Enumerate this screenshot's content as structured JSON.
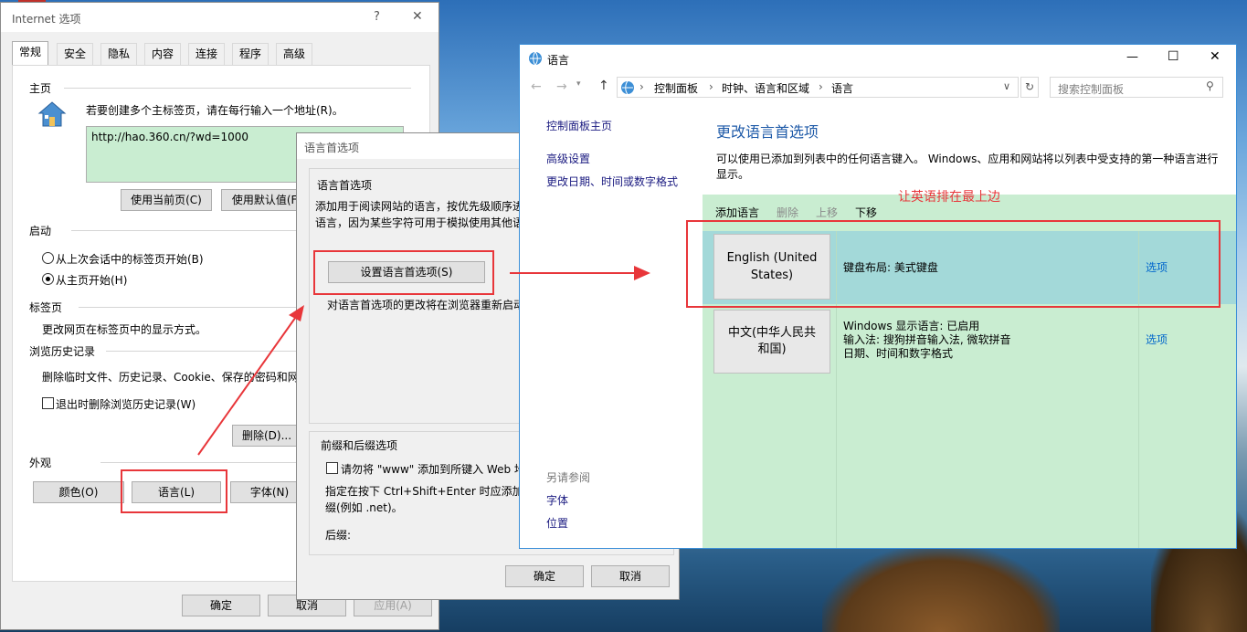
{
  "ie_options": {
    "title": "Internet 选项",
    "help": "?",
    "close": "✕",
    "tabs": [
      "常规",
      "安全",
      "隐私",
      "内容",
      "连接",
      "程序",
      "高级"
    ],
    "home_group": "主页",
    "home_desc": "若要创建多个主标签页，请在每行输入一个地址(R)。",
    "home_url": "http://hao.360.cn/?wd=1000",
    "use_current": "使用当前页(C)",
    "use_default": "使用默认值(F)",
    "startup_group": "启动",
    "startup_opt1": "从上次会话中的标签页开始(B)",
    "startup_opt2": "从主页开始(H)",
    "tabs_group": "标签页",
    "tabs_desc": "更改网页在标签页中的显示方式。",
    "history_group": "浏览历史记录",
    "history_desc": "删除临时文件、历史记录、Cookie、保存的密码和网",
    "history_check": "退出时删除浏览历史记录(W)",
    "delete_btn": "删除(D)...",
    "appearance_group": "外观",
    "colors_btn": "颜色(O)",
    "language_btn": "语言(L)",
    "fonts_btn": "字体(N)",
    "ok": "确定",
    "cancel": "取消",
    "apply": "应用(A)"
  },
  "lang_pref": {
    "title": "语言首选项",
    "group1": "语言首选项",
    "desc1": "添加用于阅读网站的语言，按优先级顺序进",
    "desc2": "语言，因为某些字符可用于模拟使用其他语",
    "set_btn": "设置语言首选项(S)",
    "restart_note": "对语言首选项的更改将在浏览器重新启动",
    "group2": "前缀和后缀选项",
    "www_check": "请勿将 \"www\" 添加到所键入 Web 地",
    "suffix_desc1": "指定在按下 Ctrl+Shift+Enter 时应添加到",
    "suffix_desc2": "缀(例如 .net)。",
    "suffix_label": "后缀:",
    "ok": "确定",
    "cancel": "取消"
  },
  "language_window": {
    "title": "语言",
    "min": "—",
    "max": "☐",
    "close": "✕",
    "breadcrumb": [
      "控制面板",
      "时钟、语言和区域",
      "语言"
    ],
    "search_placeholder": "搜索控制面板",
    "sidebar_home": "控制面板主页",
    "sidebar_advanced": "高级设置",
    "sidebar_datetime": "更改日期、时间或数字格式",
    "see_also": "另请参阅",
    "see_fonts": "字体",
    "see_location": "位置",
    "heading": "更改语言首选项",
    "desc": "可以使用已添加到列表中的任何语言键入。 Windows、应用和网站将以列表中受支持的第一种语言进行显示。",
    "toolbar": {
      "add": "添加语言",
      "remove": "删除",
      "up": "上移",
      "down": "下移"
    },
    "annotation": "让英语排在最上边",
    "languages": [
      {
        "name": "English (United States)",
        "info": "键盘布局: 美式键盘",
        "options": "选项"
      },
      {
        "name": "中文(中华人民共和国)",
        "info_lines": [
          "Windows 显示语言: 已启用",
          "输入法: 搜狗拼音输入法, 微软拼音",
          "日期、时间和数字格式"
        ],
        "options": "选项"
      }
    ]
  },
  "colors": {
    "highlight": "#e8363a",
    "selected_row": "#a3d9d9",
    "list_bg": "#c9edd1",
    "link": "#0066cc",
    "heading": "#1e5aa8"
  }
}
